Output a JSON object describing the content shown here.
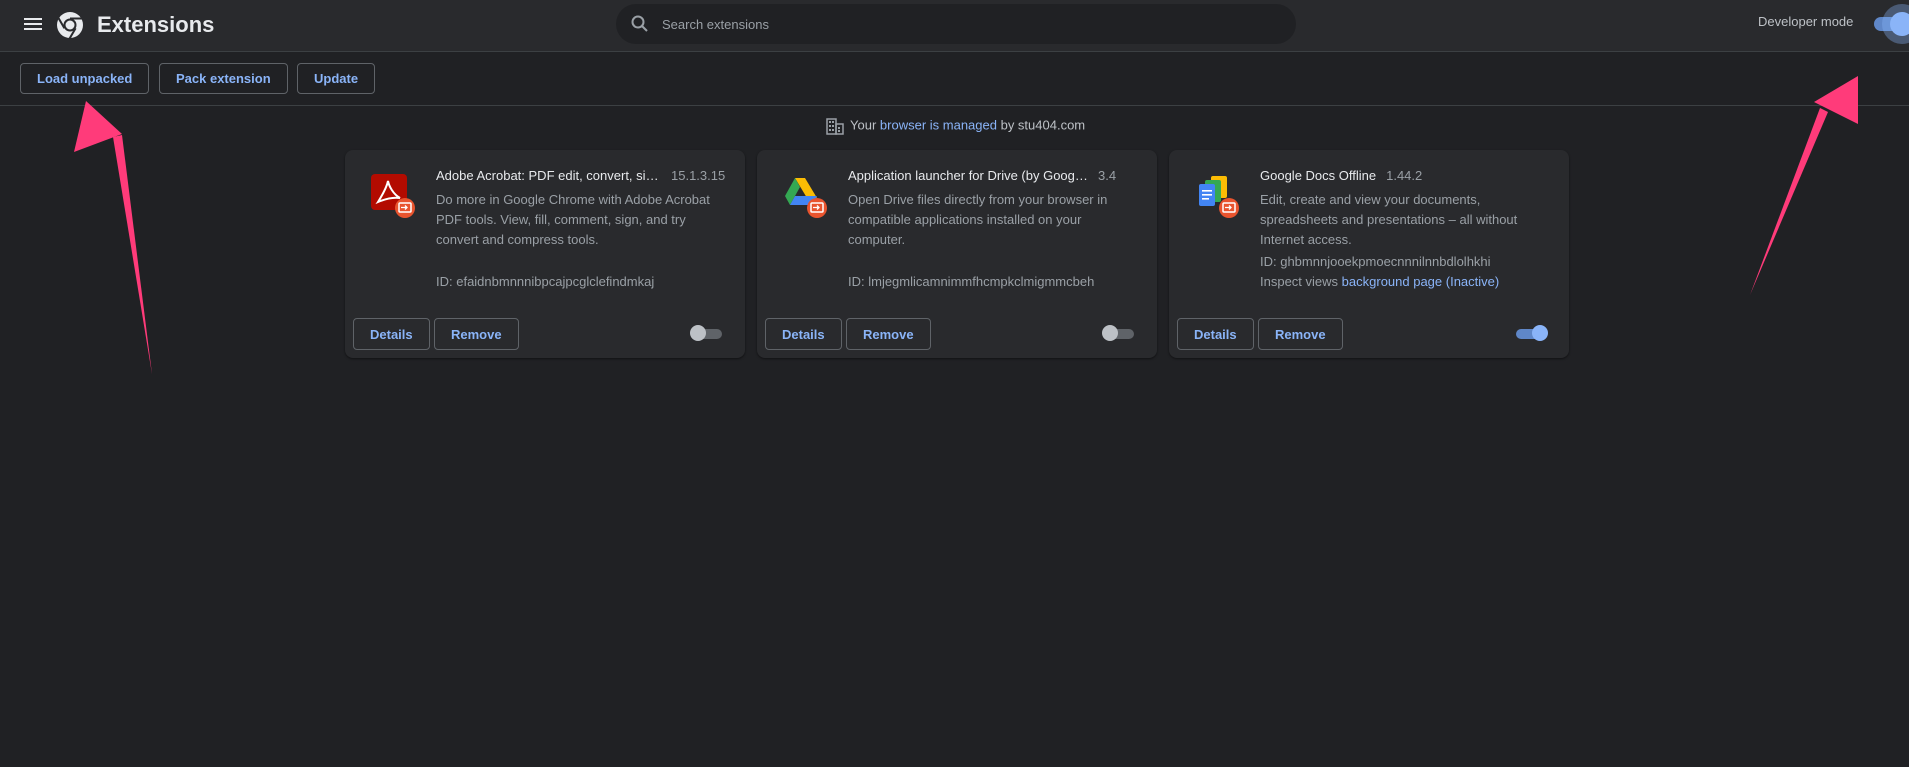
{
  "header": {
    "title": "Extensions",
    "search_placeholder": "Search extensions",
    "developer_mode_label": "Developer mode",
    "developer_mode_on": true
  },
  "toolbar": {
    "load_unpacked": "Load unpacked",
    "pack_extension": "Pack extension",
    "update": "Update"
  },
  "managed_notice": {
    "prefix": "Your",
    "link": "browser is managed",
    "suffix": "by stu404.com"
  },
  "extensions": [
    {
      "name": "Adobe Acrobat: PDF edit, convert, sig…",
      "version": "15.1.3.15",
      "description": "Do more in Google Chrome with Adobe Acrobat PDF tools. View, fill, comment, sign, and try convert and compress tools.",
      "id_text": "ID: efaidnbmnnnibpcajpcglclefindmkaj",
      "details": "Details",
      "remove": "Remove",
      "enabled": false,
      "icon": "adobe-acrobat-icon"
    },
    {
      "name": "Application launcher for Drive (by Google)",
      "version": "3.4",
      "description": "Open Drive files directly from your browser in compatible applications installed on your computer.",
      "id_text": "ID: lmjegmlicamnimmfhcmpkclmigmmcbeh",
      "details": "Details",
      "remove": "Remove",
      "enabled": false,
      "icon": "google-drive-icon"
    },
    {
      "name": "Google Docs Offline",
      "version": "1.44.2",
      "description": "Edit, create and view your documents, spreadsheets and presentations – all without Internet access.",
      "id_text": "ID: ghbmnnjooekpmoecnnnilnnbdlolhkhi",
      "inspect_label": "Inspect views",
      "inspect_link": "background page (Inactive)",
      "details": "Details",
      "remove": "Remove",
      "enabled": true,
      "icon": "google-docs-icon"
    }
  ],
  "colors": {
    "background": "#202124",
    "surface": "#292a2d",
    "accent": "#8ab4f8",
    "annotation_arrow": "#ff3b7a"
  }
}
